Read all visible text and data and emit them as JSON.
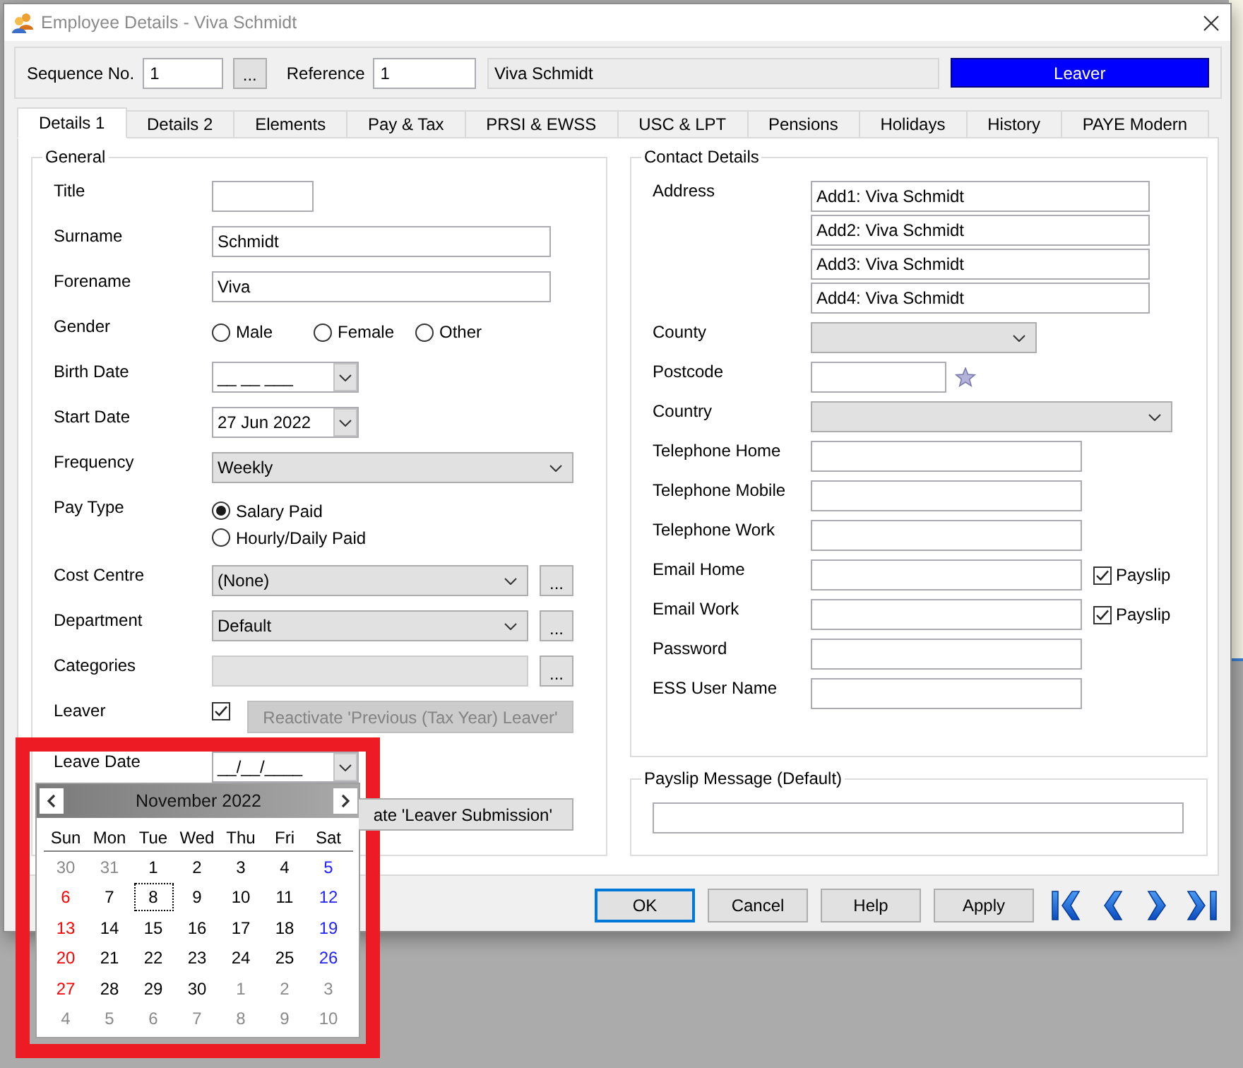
{
  "window": {
    "title": "Employee Details - Viva Schmidt"
  },
  "header": {
    "sequence_label": "Sequence No.",
    "sequence_value": "1",
    "lookup_button": "...",
    "reference_label": "Reference",
    "reference_value": "1",
    "employee_name": "Viva Schmidt",
    "status": "Leaver"
  },
  "tabs": [
    {
      "label": "Details 1",
      "selected": true
    },
    {
      "label": "Details 2",
      "selected": false
    },
    {
      "label": "Elements",
      "selected": false
    },
    {
      "label": "Pay & Tax",
      "selected": false
    },
    {
      "label": "PRSI & EWSS",
      "selected": false
    },
    {
      "label": "USC & LPT",
      "selected": false
    },
    {
      "label": "Pensions",
      "selected": false
    },
    {
      "label": "Holidays",
      "selected": false
    },
    {
      "label": "History",
      "selected": false
    },
    {
      "label": "PAYE Modern",
      "selected": false
    }
  ],
  "general": {
    "title": "General",
    "rows": [
      {
        "label": "Title",
        "kind": "short_text",
        "disabled": false
      },
      {
        "label": "Surname",
        "kind": "text",
        "value": "Schmidt",
        "disabled": false
      },
      {
        "label": "Forename",
        "kind": "text",
        "value": "Viva",
        "disabled": false
      },
      {
        "label": "Gender",
        "kind": "radio_row",
        "options": [
          {
            "label": "Male",
            "selected": false
          },
          {
            "label": "Female",
            "selected": false
          },
          {
            "label": "Other",
            "selected": false
          }
        ]
      },
      {
        "label": "Birth Date",
        "kind": "date",
        "value": "__ __ ___"
      },
      {
        "label": "Start Date",
        "kind": "date",
        "value": "27 Jun 2022"
      },
      {
        "label": "Frequency",
        "kind": "select",
        "value": "Weekly"
      },
      {
        "label": "Pay Type",
        "kind": "radio_column",
        "options": [
          {
            "label": "Salary Paid",
            "selected": true
          },
          {
            "label": "Hourly/Daily Paid",
            "selected": false
          }
        ]
      },
      {
        "label": "Cost Centre",
        "kind": "select",
        "value": "(None)",
        "button": "..."
      },
      {
        "label": "Department",
        "kind": "select",
        "value": "Default",
        "button": "..."
      },
      {
        "label": "Categories",
        "kind": "text",
        "disabled": true,
        "button": "..."
      },
      {
        "label": "Leaver",
        "kind": "checkbox",
        "checked": true,
        "action": {
          "label": "Reactivate 'Previous (Tax Year) Leaver'",
          "disabled": true
        }
      },
      {
        "label": "Leave Date",
        "kind": "date",
        "value": "__/__/____",
        "calendar": {
          "month": "November 2022",
          "weekdays": [
            "Sun",
            "Mon",
            "Tue",
            "Wed",
            "Thu",
            "Fri",
            "Sat"
          ],
          "weeks": [
            [
              {
                "day": "30",
                "outside_month": true,
                "selected": false
              },
              {
                "day": "31",
                "outside_month": true,
                "selected": false
              },
              {
                "day": "1",
                "outside_month": false,
                "selected": false
              },
              {
                "day": "2",
                "outside_month": false,
                "selected": false
              },
              {
                "day": "3",
                "outside_month": false,
                "selected": false
              },
              {
                "day": "4",
                "outside_month": false,
                "selected": false
              },
              {
                "day": "5",
                "outside_month": false,
                "selected": false
              }
            ],
            [
              {
                "day": "6",
                "outside_month": false,
                "selected": false
              },
              {
                "day": "7",
                "outside_month": false,
                "selected": false
              },
              {
                "day": "8",
                "outside_month": false,
                "selected": true
              },
              {
                "day": "9",
                "outside_month": false,
                "selected": false
              },
              {
                "day": "10",
                "outside_month": false,
                "selected": false
              },
              {
                "day": "11",
                "outside_month": false,
                "selected": false
              },
              {
                "day": "12",
                "outside_month": false,
                "selected": false
              }
            ],
            [
              {
                "day": "13",
                "outside_month": false,
                "selected": false
              },
              {
                "day": "14",
                "outside_month": false,
                "selected": false
              },
              {
                "day": "15",
                "outside_month": false,
                "selected": false
              },
              {
                "day": "16",
                "outside_month": false,
                "selected": false
              },
              {
                "day": "17",
                "outside_month": false,
                "selected": false
              },
              {
                "day": "18",
                "outside_month": false,
                "selected": false
              },
              {
                "day": "19",
                "outside_month": false,
                "selected": false
              }
            ],
            [
              {
                "day": "20",
                "outside_month": false,
                "selected": false
              },
              {
                "day": "21",
                "outside_month": false,
                "selected": false
              },
              {
                "day": "22",
                "outside_month": false,
                "selected": false
              },
              {
                "day": "23",
                "outside_month": false,
                "selected": false
              },
              {
                "day": "24",
                "outside_month": false,
                "selected": false
              },
              {
                "day": "25",
                "outside_month": false,
                "selected": false
              },
              {
                "day": "26",
                "outside_month": false,
                "selected": false
              }
            ],
            [
              {
                "day": "27",
                "outside_month": false,
                "selected": false
              },
              {
                "day": "28",
                "outside_month": false,
                "selected": false
              },
              {
                "day": "29",
                "outside_month": false,
                "selected": false
              },
              {
                "day": "30",
                "outside_month": false,
                "selected": false
              },
              {
                "day": "1",
                "outside_month": true,
                "selected": false
              },
              {
                "day": "2",
                "outside_month": true,
                "selected": false
              },
              {
                "day": "3",
                "outside_month": true,
                "selected": false
              }
            ],
            [
              {
                "day": "4",
                "outside_month": true,
                "selected": false
              },
              {
                "day": "5",
                "outside_month": true,
                "selected": false
              },
              {
                "day": "6",
                "outside_month": true,
                "selected": false
              },
              {
                "day": "7",
                "outside_month": true,
                "selected": false
              },
              {
                "day": "8",
                "outside_month": true,
                "selected": false
              },
              {
                "day": "9",
                "outside_month": true,
                "selected": false
              },
              {
                "day": "10",
                "outside_month": true,
                "selected": false
              }
            ]
          ]
        }
      }
    ],
    "submission_button": {
      "label": "ate 'Leaver Submission'",
      "disabled": false
    }
  },
  "contact": {
    "title": "Contact Details",
    "groups": [
      [
        {
          "label": "Address",
          "kind": "address",
          "lines": [
            "Add1: Viva Schmidt",
            "Add2: Viva Schmidt",
            "Add3: Viva Schmidt",
            "Add4: Viva Schmidt"
          ]
        },
        {
          "label": "County",
          "kind": "short_select"
        },
        {
          "label": "Postcode",
          "kind": "postcode"
        },
        {
          "label": "Country",
          "kind": "select"
        }
      ],
      [
        {
          "label": "Telephone Home",
          "kind": "text"
        },
        {
          "label": "Telephone Mobile",
          "kind": "text"
        },
        {
          "label": "Telephone Work",
          "kind": "text"
        }
      ],
      [
        {
          "label": "Email Home",
          "kind": "email",
          "payslip": {
            "label": "Payslip",
            "checked": true
          }
        },
        {
          "label": "Email Work",
          "kind": "email",
          "payslip": {
            "label": "Payslip",
            "checked": true
          }
        }
      ],
      [
        {
          "label": "Password",
          "kind": "text"
        }
      ],
      [
        {
          "label": "ESS User Name",
          "kind": "text"
        }
      ]
    ]
  },
  "payslip_message": {
    "title": "Payslip Message (Default)"
  },
  "buttons": [
    {
      "label": "OK",
      "default": true
    },
    {
      "label": "Cancel",
      "default": false
    },
    {
      "label": "Help",
      "default": false
    },
    {
      "label": "Apply",
      "default": false
    }
  ]
}
